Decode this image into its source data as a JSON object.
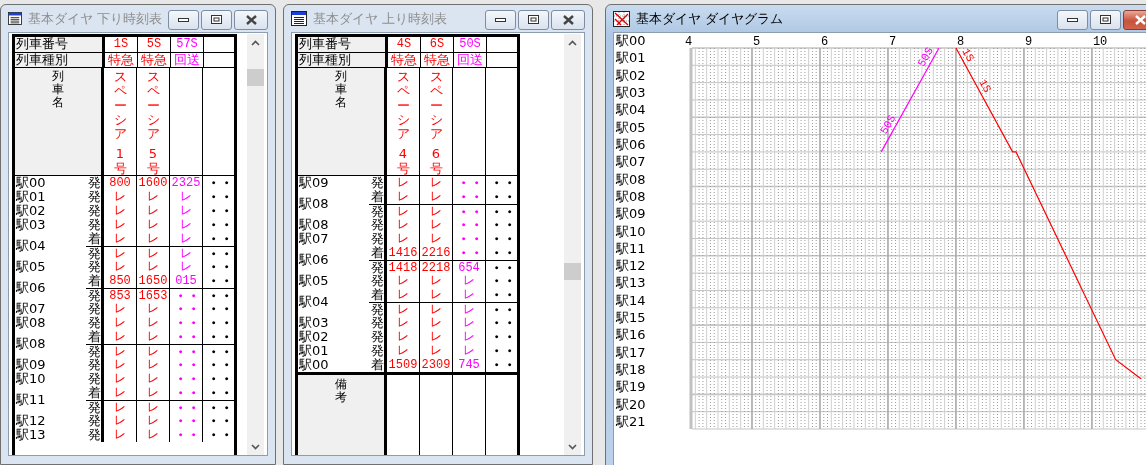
{
  "windows": [
    {
      "kind": "timetable",
      "title": "基本ダイヤ 下り時刻表",
      "active": false,
      "header": {
        "number_label": "列車番号",
        "type_label": "列車種別",
        "name_label": "列車名"
      },
      "trains": [
        {
          "number": "1S",
          "type": "特急",
          "name": "スペーシア",
          "name_number": "1号",
          "color": "#ff0000"
        },
        {
          "number": "5S",
          "type": "特急",
          "name": "スペーシア",
          "name_number": "5号",
          "color": "#ff0000"
        },
        {
          "number": "57S",
          "type": "回送",
          "color": "#ff00ff"
        },
        {
          "color": "#000000"
        }
      ],
      "stations": [
        {
          "name": "駅00",
          "stops": [
            {
              "kind_label": "発",
              "times": [
                "800",
                "1600",
                "2325",
                "・・"
              ]
            }
          ]
        },
        {
          "name": "駅01",
          "stops": [
            {
              "kind_label": "発",
              "times": [
                "レ",
                "レ",
                "レ",
                "・・"
              ]
            }
          ]
        },
        {
          "name": "駅02",
          "stops": [
            {
              "kind_label": "発",
              "times": [
                "レ",
                "レ",
                "レ",
                "・・"
              ]
            }
          ]
        },
        {
          "name": "駅03",
          "stops": [
            {
              "kind_label": "発",
              "times": [
                "レ",
                "レ",
                "レ",
                "・・"
              ]
            }
          ]
        },
        {
          "name": "駅04",
          "stops": [
            {
              "kind_label": "着",
              "times": [
                "レ",
                "レ",
                "レ",
                "・・"
              ]
            },
            {
              "kind_label": "発",
              "times": [
                "レ",
                "レ",
                "レ",
                "・・"
              ]
            }
          ]
        },
        {
          "name": "駅05",
          "stops": [
            {
              "kind_label": "発",
              "times": [
                "レ",
                "レ",
                "レ",
                "・・"
              ]
            }
          ]
        },
        {
          "name": "駅06",
          "stops": [
            {
              "kind_label": "着",
              "times": [
                "850",
                "1650",
                "015",
                "・・"
              ]
            },
            {
              "kind_label": "発",
              "times": [
                "853",
                "1653",
                "・・",
                "・・"
              ]
            }
          ]
        },
        {
          "name": "駅07",
          "stops": [
            {
              "kind_label": "発",
              "times": [
                "レ",
                "レ",
                "・・",
                "・・"
              ]
            }
          ]
        },
        {
          "name": "駅08",
          "stops": [
            {
              "kind_label": "発",
              "times": [
                "レ",
                "レ",
                "・・",
                "・・"
              ]
            }
          ]
        },
        {
          "name": "駅08",
          "stops": [
            {
              "kind_label": "着",
              "times": [
                "レ",
                "レ",
                "・・",
                "・・"
              ]
            },
            {
              "kind_label": "発",
              "times": [
                "レ",
                "レ",
                "・・",
                "・・"
              ]
            }
          ]
        },
        {
          "name": "駅09",
          "stops": [
            {
              "kind_label": "発",
              "times": [
                "レ",
                "レ",
                "・・",
                "・・"
              ]
            }
          ]
        },
        {
          "name": "駅10",
          "stops": [
            {
              "kind_label": "発",
              "times": [
                "レ",
                "レ",
                "・・",
                "・・"
              ]
            }
          ]
        },
        {
          "name": "駅11",
          "stops": [
            {
              "kind_label": "着",
              "times": [
                "レ",
                "レ",
                "・・",
                "・・"
              ]
            },
            {
              "kind_label": "発",
              "times": [
                "レ",
                "レ",
                "・・",
                "・・"
              ]
            }
          ]
        },
        {
          "name": "駅12",
          "stops": [
            {
              "kind_label": "発",
              "times": [
                "レ",
                "レ",
                "・・",
                "・・"
              ]
            }
          ]
        },
        {
          "name": "駅13",
          "stops": [
            {
              "kind_label": "発",
              "times": [
                "レ",
                "レ",
                "・・",
                "・・"
              ]
            }
          ]
        }
      ]
    },
    {
      "kind": "timetable",
      "title": "基本ダイヤ 上り時刻表",
      "active": false,
      "header": {
        "number_label": "列車番号",
        "type_label": "列車種別",
        "name_label": "列車名"
      },
      "trains": [
        {
          "number": "4S",
          "type": "特急",
          "name": "スペーシア",
          "name_number": "4号",
          "color": "#ff0000"
        },
        {
          "number": "6S",
          "type": "特急",
          "name": "スペーシア",
          "name_number": "6号",
          "color": "#ff0000"
        },
        {
          "number": "50S",
          "type": "回送",
          "color": "#ff00ff"
        },
        {
          "color": "#000000"
        }
      ],
      "stations": [
        {
          "name": "駅09",
          "stops": [
            {
              "kind_label": "発",
              "times": [
                "レ",
                "レ",
                "・・",
                "・・"
              ]
            }
          ]
        },
        {
          "name": "駅08",
          "stops": [
            {
              "kind_label": "着",
              "times": [
                "レ",
                "レ",
                "・・",
                "・・"
              ]
            },
            {
              "kind_label": "発",
              "times": [
                "レ",
                "レ",
                "・・",
                "・・"
              ]
            }
          ]
        },
        {
          "name": "駅08",
          "stops": [
            {
              "kind_label": "発",
              "times": [
                "レ",
                "レ",
                "・・",
                "・・"
              ]
            }
          ]
        },
        {
          "name": "駅07",
          "stops": [
            {
              "kind_label": "発",
              "times": [
                "レ",
                "レ",
                "・・",
                "・・"
              ]
            }
          ]
        },
        {
          "name": "駅06",
          "stops": [
            {
              "kind_label": "着",
              "times": [
                "1416",
                "2216",
                "・・",
                "・・"
              ]
            },
            {
              "kind_label": "発",
              "times": [
                "1418",
                "2218",
                "654",
                "・・"
              ]
            }
          ]
        },
        {
          "name": "駅05",
          "stops": [
            {
              "kind_label": "発",
              "times": [
                "レ",
                "レ",
                "レ",
                "・・"
              ]
            }
          ]
        },
        {
          "name": "駅04",
          "stops": [
            {
              "kind_label": "着",
              "times": [
                "レ",
                "レ",
                "レ",
                "・・"
              ]
            },
            {
              "kind_label": "発",
              "times": [
                "レ",
                "レ",
                "レ",
                "・・"
              ]
            }
          ]
        },
        {
          "name": "駅03",
          "stops": [
            {
              "kind_label": "発",
              "times": [
                "レ",
                "レ",
                "レ",
                "・・"
              ]
            }
          ]
        },
        {
          "name": "駅02",
          "stops": [
            {
              "kind_label": "発",
              "times": [
                "レ",
                "レ",
                "レ",
                "・・"
              ]
            }
          ]
        },
        {
          "name": "駅01",
          "stops": [
            {
              "kind_label": "発",
              "times": [
                "レ",
                "レ",
                "レ",
                "・・"
              ]
            }
          ]
        },
        {
          "name": "駅00",
          "stops": [
            {
              "kind_label": "着",
              "times": [
                "1509",
                "2309",
                "745",
                "・・"
              ]
            }
          ]
        }
      ],
      "remarks_label": "備考"
    },
    {
      "kind": "diagram",
      "title": "基本ダイヤ ダイヤグラム",
      "active": true,
      "hours": [
        "4",
        "5",
        "6",
        "7",
        "8",
        "9",
        "10"
      ],
      "stations": [
        "駅00",
        "駅01",
        "駅02",
        "駅03",
        "駅04",
        "駅05",
        "駅06",
        "駅07",
        "駅08",
        "駅08",
        "駅09",
        "駅10",
        "駅11",
        "駅12",
        "駅13",
        "駅14",
        "駅15",
        "駅16",
        "駅17",
        "駅18",
        "駅19",
        "駅20",
        "駅21"
      ],
      "trains": [
        {
          "color": "#ff00ff",
          "labels": [
            "50S",
            "50S"
          ]
        },
        {
          "color": "#ff0000",
          "labels": [
            "1S",
            "1S"
          ]
        }
      ]
    }
  ]
}
